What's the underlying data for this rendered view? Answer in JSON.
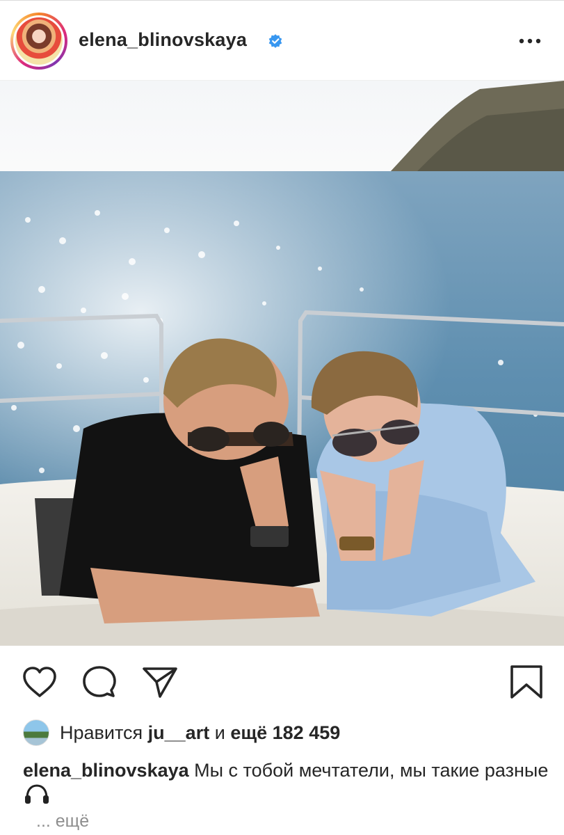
{
  "post": {
    "username": "elena_blinovskaya",
    "verified": true,
    "more_icon": "more-horizontal-icon"
  },
  "actions": {
    "like_icon": "heart-icon",
    "comment_icon": "comment-icon",
    "share_icon": "paper-plane-icon",
    "save_icon": "bookmark-icon"
  },
  "likes": {
    "prefix": "Нравится",
    "user": "ju__art",
    "connector": "и",
    "more_count": "ещё 182 459"
  },
  "caption": {
    "username": "elena_blinovskaya",
    "text": "Мы с тобой мечтатели, мы такие разные",
    "emoji_icon": "headphones-icon",
    "more": "... ещё"
  },
  "colors": {
    "verified": "#3897f0",
    "text": "#262626",
    "muted": "#8e8e8e"
  }
}
